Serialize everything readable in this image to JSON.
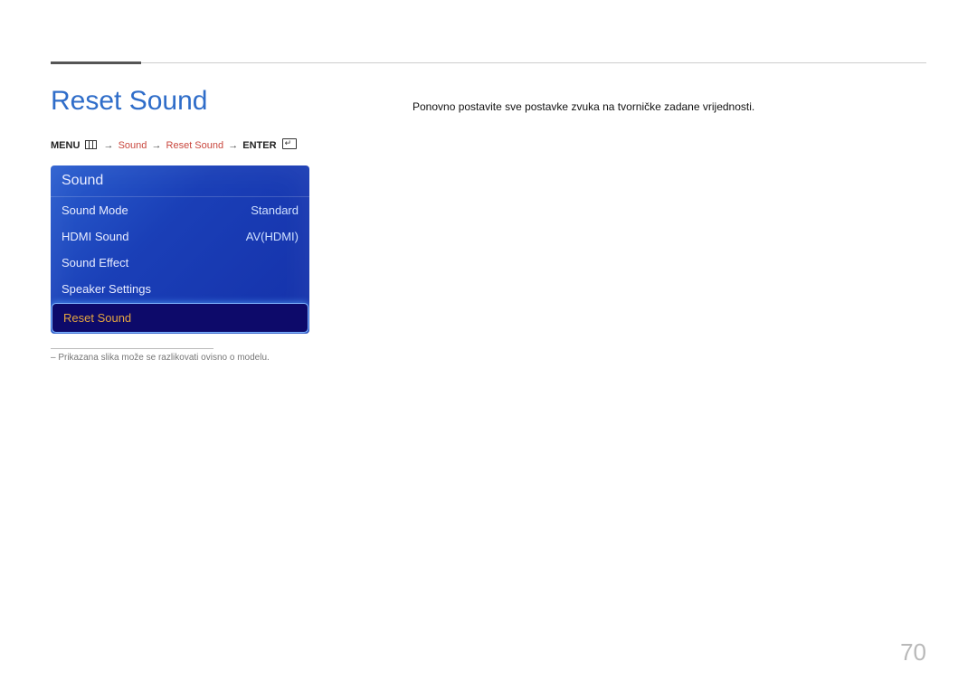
{
  "page": {
    "number": "70",
    "title": "Reset Sound",
    "description": "Ponovno postavite sve postavke zvuka na tvorničke zadane vrijednosti."
  },
  "breadcrumb": {
    "menu": "MENU",
    "sound": "Sound",
    "reset_sound": "Reset Sound",
    "enter": "ENTER"
  },
  "menu": {
    "header": "Sound",
    "items": {
      "sound_mode": {
        "label": "Sound Mode",
        "value": "Standard"
      },
      "hdmi_sound": {
        "label": "HDMI Sound",
        "value": "AV(HDMI)"
      },
      "sound_effect": {
        "label": "Sound Effect",
        "value": ""
      },
      "speaker_settings": {
        "label": "Speaker Settings",
        "value": ""
      },
      "reset_sound": {
        "label": "Reset Sound",
        "value": ""
      }
    }
  },
  "footnote": "–  Prikazana slika može se razlikovati ovisno o modelu."
}
